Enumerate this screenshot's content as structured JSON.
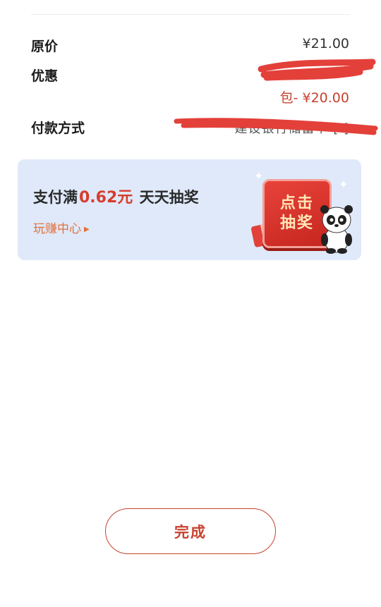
{
  "order": {
    "original_price_label": "原价",
    "original_price_value": "¥21.00",
    "discount_label": "优惠",
    "discount_value_line1": "",
    "discount_value_line2": "包- ¥20.00",
    "payment_label": "付款方式",
    "payment_value": "建设银行储蓄卡 [     ]"
  },
  "promo": {
    "title_prefix": "支付满",
    "title_amount": "0.62元",
    "title_suffix": " 天天抽奖",
    "subtitle": "玩赚中心",
    "draw_button_line1": "点击",
    "draw_button_line2": "抽奖"
  },
  "actions": {
    "done_label": "完成"
  },
  "colors": {
    "accent": "#c8412f",
    "promo_bg": "#dfe9fa",
    "promo_orange": "#e0703c"
  }
}
